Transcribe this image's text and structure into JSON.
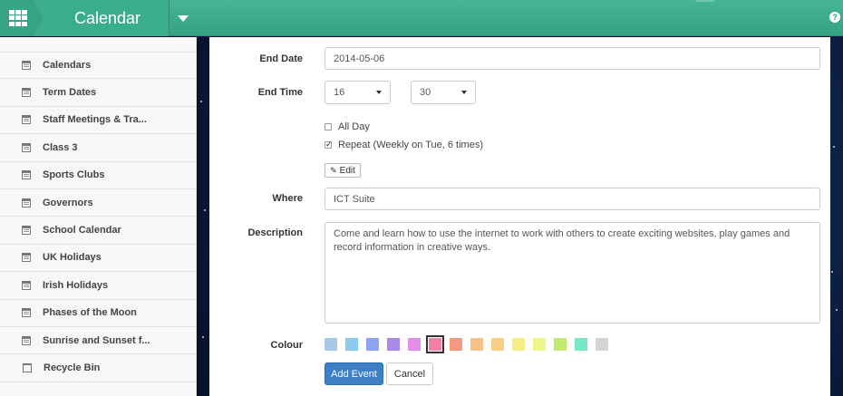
{
  "header": {
    "title": "Calendar",
    "help_icon": "question-circle-icon",
    "apps_icon": "grid-icon",
    "accent": "#3aad8c"
  },
  "sidebar": {
    "items": [
      {
        "label": "Calendars",
        "icon": "calendar-icon"
      },
      {
        "label": "Term Dates",
        "icon": "calendar-icon"
      },
      {
        "label": "Staff Meetings & Tra...",
        "icon": "calendar-icon"
      },
      {
        "label": "Class 3",
        "icon": "calendar-icon"
      },
      {
        "label": "Sports Clubs",
        "icon": "calendar-icon"
      },
      {
        "label": "Governors",
        "icon": "calendar-icon"
      },
      {
        "label": "School Calendar",
        "icon": "calendar-icon"
      },
      {
        "label": "UK Holidays",
        "icon": "calendar-icon"
      },
      {
        "label": "Irish Holidays",
        "icon": "calendar-icon"
      },
      {
        "label": "Phases of the Moon",
        "icon": "calendar-icon"
      },
      {
        "label": "Sunrise and Sunset f...",
        "icon": "calendar-icon"
      },
      {
        "label": "Recycle Bin",
        "icon": "trash-icon"
      }
    ]
  },
  "form": {
    "end_date_label": "End Date",
    "end_date_value": "2014-05-06",
    "end_time_label": "End Time",
    "end_hour": "16",
    "end_minute": "30",
    "all_day_label": "All Day",
    "all_day_checked": false,
    "repeat_label": "Repeat (Weekly on Tue, 6 times)",
    "repeat_checked": true,
    "edit_label": "Edit",
    "where_label": "Where",
    "where_value": "ICT Suite",
    "description_label": "Description",
    "description_value": "Come and learn how to use the internet to work with others to create exciting websites, play games and record information in creative ways.",
    "colour_label": "Colour",
    "colours": [
      "#a8c8e6",
      "#8ccbf0",
      "#8ea4f0",
      "#a98ae8",
      "#e38ee8",
      "#f280aa",
      "#f39a80",
      "#f7c08a",
      "#f7d088",
      "#f5ee86",
      "#eef58a",
      "#c2ea6e",
      "#76e8c8",
      "#d6d6d6"
    ],
    "selected_colour": "#f280aa",
    "add_event_label": "Add Event",
    "cancel_label": "Cancel"
  }
}
